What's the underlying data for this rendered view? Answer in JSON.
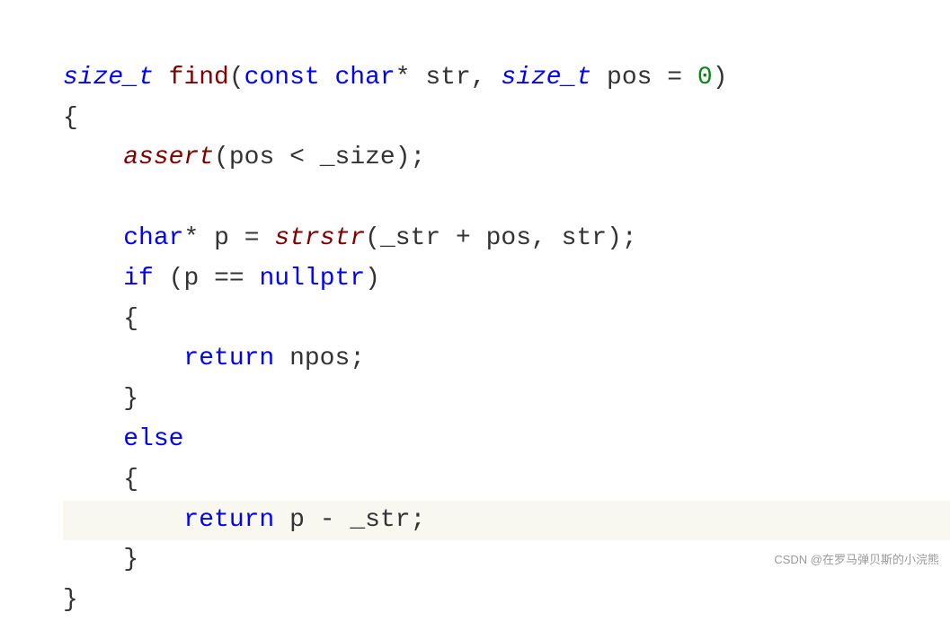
{
  "code": {
    "line1": {
      "type1": "size_t",
      "func": "find",
      "kw_const": "const",
      "kw_char": "char",
      "star": "*",
      "param1": "str",
      "comma1": ",",
      "type2": "size_t",
      "param2": "pos",
      "eq": "=",
      "zero": "0",
      "paren_open": "(",
      "paren_close": ")"
    },
    "line2": {
      "brace": "{"
    },
    "line3": {
      "func": "assert",
      "paren_open": "(",
      "var1": "pos",
      "lt": "<",
      "var2": "_size",
      "paren_close": ")",
      "semi": ";"
    },
    "line5": {
      "kw_char": "char",
      "star": "*",
      "var": "p",
      "eq": "=",
      "func": "strstr",
      "paren_open": "(",
      "var1": "_str",
      "plus": "+",
      "var2": "pos",
      "comma": ",",
      "var3": "str",
      "paren_close": ")",
      "semi": ";"
    },
    "line6": {
      "kw_if": "if",
      "paren_open": "(",
      "var": "p",
      "eqeq": "==",
      "kw_nullptr": "nullptr",
      "paren_close": ")"
    },
    "line7": {
      "brace": "{"
    },
    "line8": {
      "kw_return": "return",
      "var": "npos",
      "semi": ";"
    },
    "line9": {
      "brace": "}"
    },
    "line10": {
      "kw_else": "else"
    },
    "line11": {
      "brace": "{"
    },
    "line12": {
      "kw_return": "return",
      "var1": "p",
      "minus": "-",
      "var2": "_str",
      "semi": ";"
    },
    "line13": {
      "brace": "}"
    },
    "line14": {
      "brace": "}"
    }
  },
  "watermark": "CSDN @在罗马弹贝斯的小浣熊"
}
